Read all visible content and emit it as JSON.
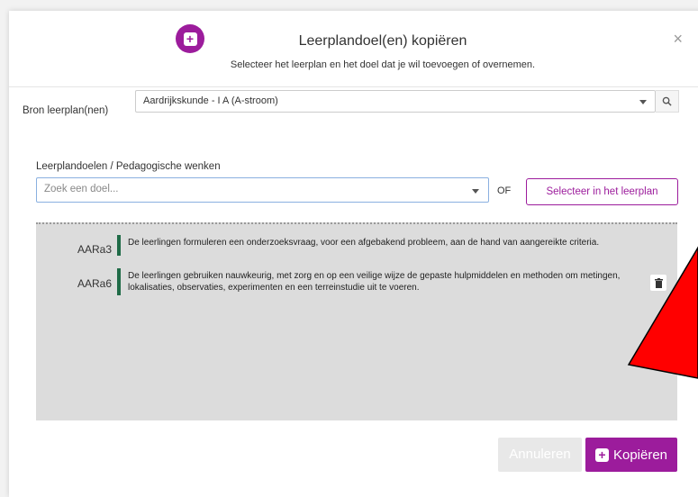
{
  "dialog": {
    "title": "Leerplandoel(en) kopiëren",
    "subtitle": "Selecteer het leerplan en het doel dat je wil toevoegen of overnemen.",
    "close_label": "×",
    "header_icon": "plus-square-icon"
  },
  "bron": {
    "label": "Bron leerplan(nen)",
    "selected": "Aardrijkskunde - I A (A-stroom)",
    "search_icon": "search-icon"
  },
  "leerplandoelen": {
    "label": "Leerplandoelen / Pedagogische wenken",
    "placeholder": "Zoek een doel...",
    "of_label": "OF",
    "select_button": "Selecteer in het leerplan"
  },
  "results": [
    {
      "code": "AARa3",
      "text": "De leerlingen formuleren een onderzoeksvraag, voor een afgebakend probleem, aan de hand van aangereikte criteria.",
      "has_delete": false
    },
    {
      "code": "AARa6",
      "text": "De leerlingen gebruiken nauwkeurig, met zorg en op een veilige wijze de gepaste hulpmiddelen en methoden om metingen, lokalisaties, observaties, experimenten en een terreinstudie uit te voeren.",
      "has_delete": true
    }
  ],
  "footer": {
    "cancel_label": "Annuleren",
    "copy_label": "Kopiëren"
  },
  "colors": {
    "accent": "#9c1c9c",
    "bar": "#1f6b47",
    "annotation_arrow": "#ff0000"
  }
}
